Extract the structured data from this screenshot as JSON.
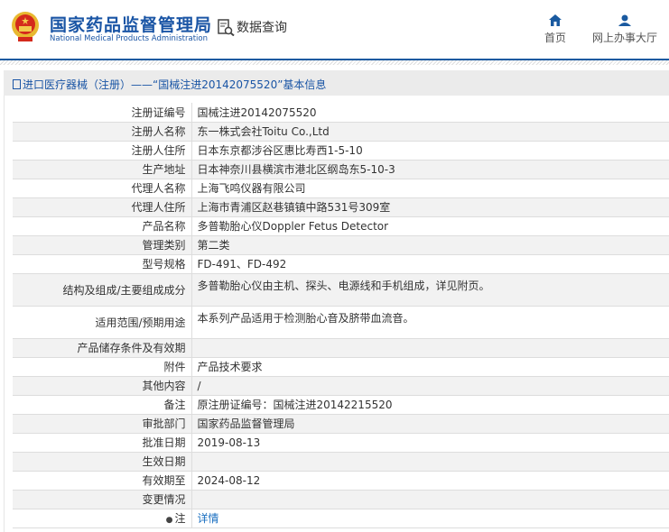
{
  "header": {
    "org_cn": "国家药品监督管理局",
    "org_en": "National Medical Products Administration",
    "query": "数据查询",
    "nav": [
      {
        "label": "首页",
        "icon": "home-icon"
      },
      {
        "label": "网上办事大厅",
        "icon": "user-icon"
      }
    ]
  },
  "title": "进口医疗器械（注册）——“国械注进20142075520”基本信息",
  "rows": [
    {
      "label": "注册证编号",
      "value": "国械注进20142075520"
    },
    {
      "label": "注册人名称",
      "value": "东一株式会社Toitu Co.,Ltd"
    },
    {
      "label": "注册人住所",
      "value": "日本东京都涉谷区惠比寿西1-5-10"
    },
    {
      "label": "生产地址",
      "value": "日本神奈川县横滨市港北区纲岛东5-10-3"
    },
    {
      "label": "代理人名称",
      "value": "上海飞鸣仪器有限公司"
    },
    {
      "label": "代理人住所",
      "value": "上海市青浦区赵巷镇镇中路531号309室"
    },
    {
      "label": "产品名称",
      "value": "多普勒胎心仪Doppler Fetus Detector"
    },
    {
      "label": "管理类别",
      "value": "第二类"
    },
    {
      "label": "型号规格",
      "value": "FD-491、FD-492"
    },
    {
      "label": "结构及组成/主要组成成分",
      "value": "多普勒胎心仪由主机、探头、电源线和手机组成，详见附页。"
    },
    {
      "label": "适用范围/预期用途",
      "value": "本系列产品适用于检测胎心音及脐带血流音。"
    },
    {
      "label": "产品储存条件及有效期",
      "value": ""
    },
    {
      "label": "附件",
      "value": "产品技术要求"
    },
    {
      "label": "其他内容",
      "value": "/"
    },
    {
      "label": "备注",
      "value": "原注册证编号：国械注进20142215520"
    },
    {
      "label": "审批部门",
      "value": "国家药品监督管理局"
    },
    {
      "label": "批准日期",
      "value": "2019-08-13"
    },
    {
      "label": "生效日期",
      "value": ""
    },
    {
      "label": "有效期至",
      "value": "2024-08-12"
    },
    {
      "label": "变更情况",
      "value": ""
    },
    {
      "label": "注",
      "value": "详情"
    }
  ]
}
